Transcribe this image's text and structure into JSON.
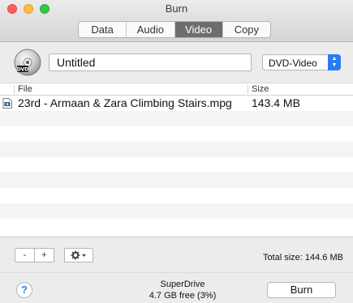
{
  "window": {
    "title": "Burn"
  },
  "tabs": [
    {
      "label": "Data",
      "active": false
    },
    {
      "label": "Audio",
      "active": false
    },
    {
      "label": "Video",
      "active": true
    },
    {
      "label": "Copy",
      "active": false
    }
  ],
  "disc": {
    "icon": "dvd-disc-icon",
    "name_value": "Untitled",
    "format_selected": "DVD-Video"
  },
  "table": {
    "columns": [
      "File",
      "Size"
    ],
    "rows": [
      {
        "file": "23rd - Armaan & Zara Climbing Stairs.mpg",
        "size": "143.4 MB",
        "icon": "video-file-icon"
      }
    ]
  },
  "actions": {
    "remove_label": "-",
    "add_label": "+",
    "gear_icon": "gear-icon",
    "total_size": "Total size: 144.6 MB"
  },
  "footer": {
    "help_label": "?",
    "drive_name": "SuperDrive",
    "drive_free": "4.7 GB free (3%)",
    "burn_label": "Burn"
  },
  "colors": {
    "accent": "#2a7cf6",
    "active_tab": "#6d6d6d"
  }
}
